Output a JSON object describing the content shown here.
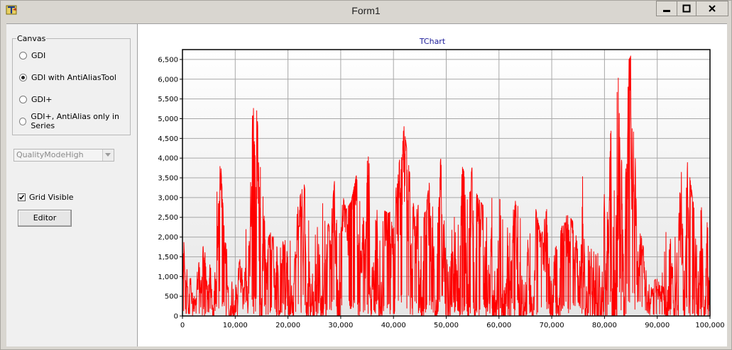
{
  "window": {
    "title": "Form1"
  },
  "canvas": {
    "caption": "Canvas",
    "options": [
      {
        "label": "GDI",
        "selected": false
      },
      {
        "label": "GDI with AntiAliasTool",
        "selected": true
      },
      {
        "label": "GDI+",
        "selected": false
      },
      {
        "label": "GDI+, AntiAlias only in Series",
        "selected": false
      }
    ]
  },
  "quality_select": {
    "value": "QualityModeHigh",
    "enabled": false
  },
  "grid_visible": {
    "label": "Grid Visible",
    "checked": true
  },
  "editor_button": {
    "label": "Editor"
  },
  "chart_data": {
    "type": "line",
    "title": "TChart",
    "xlabel": "",
    "ylabel": "",
    "xlim": [
      0,
      100000
    ],
    "ylim": [
      0,
      6750
    ],
    "x_ticks": [
      0,
      10000,
      20000,
      30000,
      40000,
      50000,
      60000,
      70000,
      80000,
      90000,
      100000
    ],
    "x_tick_labels": [
      "0",
      "10,000",
      "20,000",
      "30,000",
      "40,000",
      "50,000",
      "60,000",
      "70,000",
      "80,000",
      "90,000",
      "100,000"
    ],
    "y_ticks": [
      0,
      500,
      1000,
      1500,
      2000,
      2500,
      3000,
      3500,
      4000,
      4500,
      5000,
      5500,
      6000,
      6500
    ],
    "y_tick_labels": [
      "0",
      "500",
      "1,000",
      "1,500",
      "2,000",
      "2,500",
      "3,000",
      "3,500",
      "4,000",
      "4,500",
      "5,000",
      "5,500",
      "6,000",
      "6,500"
    ],
    "grid": true,
    "series": [
      {
        "color": "#ff0000",
        "envelope_x": [
          0,
          1000,
          2000,
          3000,
          4000,
          5000,
          6000,
          7000,
          8000,
          9000,
          10000,
          11000,
          12000,
          13000,
          14000,
          15000,
          16000,
          17000,
          18000,
          19000,
          20000,
          21000,
          22000,
          23000,
          24000,
          25000,
          26000,
          27000,
          28000,
          29000,
          30000,
          31000,
          32000,
          33000,
          34000,
          35000,
          36000,
          37000,
          38000,
          39000,
          40000,
          41000,
          42000,
          43000,
          44000,
          45000,
          46000,
          47000,
          48000,
          49000,
          50000,
          51000,
          52000,
          53000,
          54000,
          55000,
          56000,
          57000,
          58000,
          59000,
          60000,
          61000,
          62000,
          63000,
          64000,
          65000,
          66000,
          67000,
          68000,
          69000,
          70000,
          71000,
          72000,
          73000,
          74000,
          75000,
          76000,
          77000,
          78000,
          79000,
          80000,
          81000,
          82000,
          83000,
          84000,
          85000,
          86000,
          87000,
          88000,
          89000,
          90000,
          91000,
          92000,
          93000,
          94000,
          95000,
          96000,
          97000,
          98000,
          99000,
          100000
        ],
        "envelope_y": [
          2000,
          1500,
          900,
          1300,
          1800,
          1200,
          2400,
          4500,
          2000,
          1200,
          900,
          1500,
          2500,
          4800,
          5800,
          3500,
          1900,
          2200,
          1700,
          2400,
          2100,
          1700,
          2900,
          3400,
          2400,
          2800,
          3500,
          2600,
          2200,
          3700,
          3300,
          2700,
          2900,
          3600,
          2600,
          4400,
          3000,
          2800,
          2700,
          2600,
          2700,
          3800,
          4800,
          3700,
          2600,
          2900,
          2600,
          3600,
          3400,
          4000,
          2500,
          2600,
          2900,
          3800,
          3400,
          3800,
          3000,
          2800,
          3600,
          4700,
          3700,
          3100,
          2200,
          2900,
          3000,
          2400,
          2400,
          2700,
          2000,
          2700,
          2700,
          1800,
          2300,
          2600,
          2400,
          2800,
          3800,
          2300,
          3000,
          3300,
          4000,
          4500,
          5300,
          6700,
          6300,
          6600,
          4400,
          2000,
          1300,
          800,
          1000,
          1100,
          2700,
          1200,
          4300,
          4400,
          3700,
          2700,
          2900,
          2500,
          2900
        ]
      }
    ]
  }
}
